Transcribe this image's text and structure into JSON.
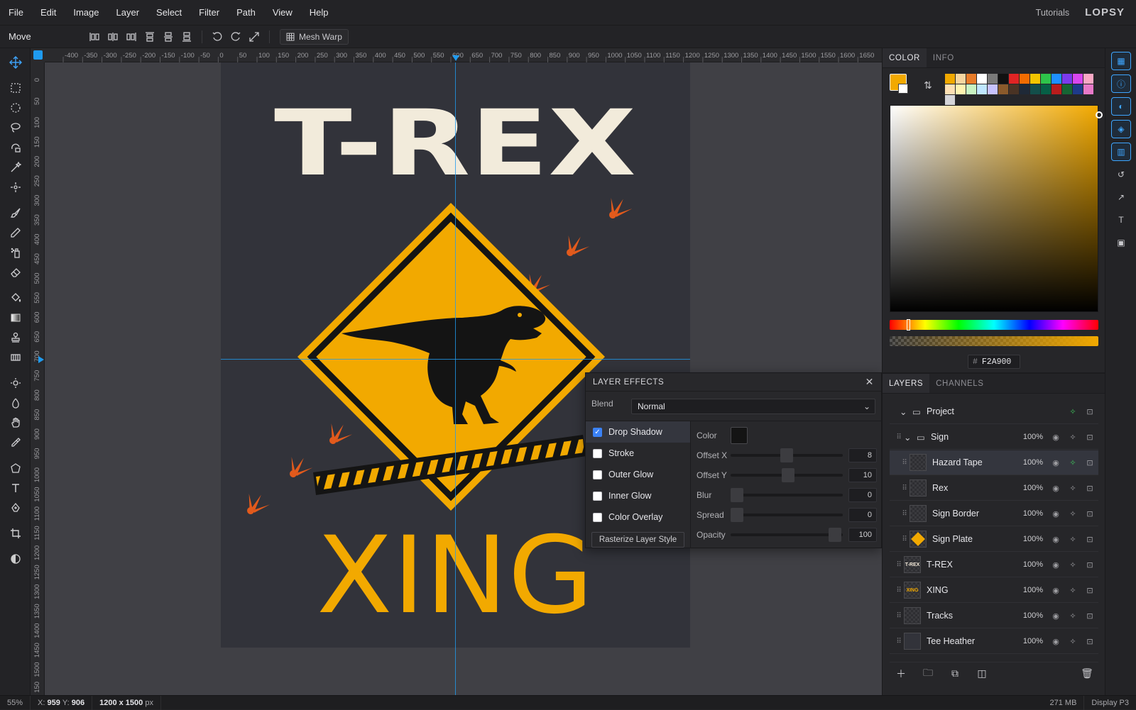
{
  "menu": {
    "items": [
      "File",
      "Edit",
      "Image",
      "Layer",
      "Select",
      "Filter",
      "Path",
      "View",
      "Help"
    ],
    "tutorials": "Tutorials",
    "logo": "LOPSY"
  },
  "options": {
    "tool_name": "Move",
    "mesh_warp": "Mesh Warp"
  },
  "ruler": {
    "h_labels": [
      "-400",
      "-350",
      "-300",
      "-250",
      "-200",
      "-150",
      "-100",
      "-50",
      "0",
      "50",
      "100",
      "150",
      "200",
      "250",
      "300",
      "350",
      "400",
      "450",
      "500",
      "550",
      "600",
      "650",
      "700",
      "750",
      "800",
      "850",
      "900",
      "950",
      "1000",
      "1050",
      "1100",
      "1150",
      "1200",
      "1250",
      "1300",
      "1350",
      "1400",
      "1450",
      "1500",
      "1550",
      "1600",
      "1650"
    ],
    "v_labels": [
      "0",
      "50",
      "100",
      "150",
      "200",
      "250",
      "300",
      "350",
      "400",
      "450",
      "500",
      "550",
      "600",
      "650",
      "700",
      "750",
      "800",
      "850",
      "900",
      "950",
      "1000",
      "1050",
      "1100",
      "1150",
      "1200",
      "1250",
      "1300",
      "1350",
      "1400",
      "1450",
      "1500",
      "150"
    ]
  },
  "artwork": {
    "title_text": "T-REX",
    "bottom_text": "XING"
  },
  "color_panel": {
    "tabs": [
      "COLOR",
      "INFO"
    ],
    "hex_prefix": "#",
    "hex": "F2A900",
    "foreground": "#f2a900",
    "swatches": [
      "#f2a900",
      "#f6d6a0",
      "#e87c2a",
      "#ffffff",
      "#7a7a7a",
      "#111111",
      "#e02424",
      "#f26c00",
      "#f2c500",
      "#2ec44a",
      "#1e90ff",
      "#7c3aed",
      "#d946ef",
      "#f9a8c4",
      "#fde0b4",
      "#fff3b0",
      "#c8f2c2",
      "#bfe6ff",
      "#c7c2ff",
      "#8a5a2b",
      "#4a3324",
      "#1f2937",
      "#134e4a",
      "#065f46",
      "#b91c1c",
      "#166534",
      "#1e3a8a",
      "#e879c8",
      "#d4d4d8"
    ]
  },
  "layers_panel": {
    "tabs": [
      "LAYERS",
      "CHANNELS"
    ],
    "rows": [
      {
        "name": "Project",
        "opacity": "",
        "thumb": "",
        "indent": 0
      },
      {
        "name": "Sign",
        "opacity": "100%",
        "thumb": "",
        "indent": 1
      },
      {
        "name": "Hazard Tape",
        "opacity": "100%",
        "thumb": "",
        "indent": 2
      },
      {
        "name": "Rex",
        "opacity": "100%",
        "thumb": "",
        "indent": 2
      },
      {
        "name": "Sign Border",
        "opacity": "100%",
        "thumb": "",
        "indent": 2
      },
      {
        "name": "Sign Plate",
        "opacity": "100%",
        "thumb": "",
        "indent": 2
      },
      {
        "name": "T-REX",
        "opacity": "100%",
        "thumb": "T-REX",
        "indent": 1
      },
      {
        "name": "XING",
        "opacity": "100%",
        "thumb": "XING",
        "indent": 1
      },
      {
        "name": "Tracks",
        "opacity": "100%",
        "thumb": "",
        "indent": 1
      },
      {
        "name": "Tee Heather",
        "opacity": "100%",
        "thumb": "",
        "indent": 1
      }
    ]
  },
  "effects": {
    "title": "LAYER EFFECTS",
    "blend_label": "Blend",
    "blend_value": "Normal",
    "list": [
      {
        "label": "Drop Shadow",
        "checked": true
      },
      {
        "label": "Stroke",
        "checked": false
      },
      {
        "label": "Outer Glow",
        "checked": false
      },
      {
        "label": "Inner Glow",
        "checked": false
      },
      {
        "label": "Color Overlay",
        "checked": false
      }
    ],
    "rasterize": "Rasterize Layer Style",
    "color_label": "Color",
    "shadow_color": "#141414",
    "params": [
      {
        "label": "Offset X",
        "value": "8"
      },
      {
        "label": "Offset Y",
        "value": "10"
      },
      {
        "label": "Blur",
        "value": "0"
      },
      {
        "label": "Spread",
        "value": "0"
      },
      {
        "label": "Opacity",
        "value": "100"
      }
    ]
  },
  "status": {
    "zoom": "55%",
    "x_label": "X:",
    "x": "959",
    "y_label": "Y:",
    "y": "906",
    "doc_size": "1200 x 1500",
    "doc_unit": "px",
    "memory": "271 MB",
    "profile": "Display P3"
  }
}
